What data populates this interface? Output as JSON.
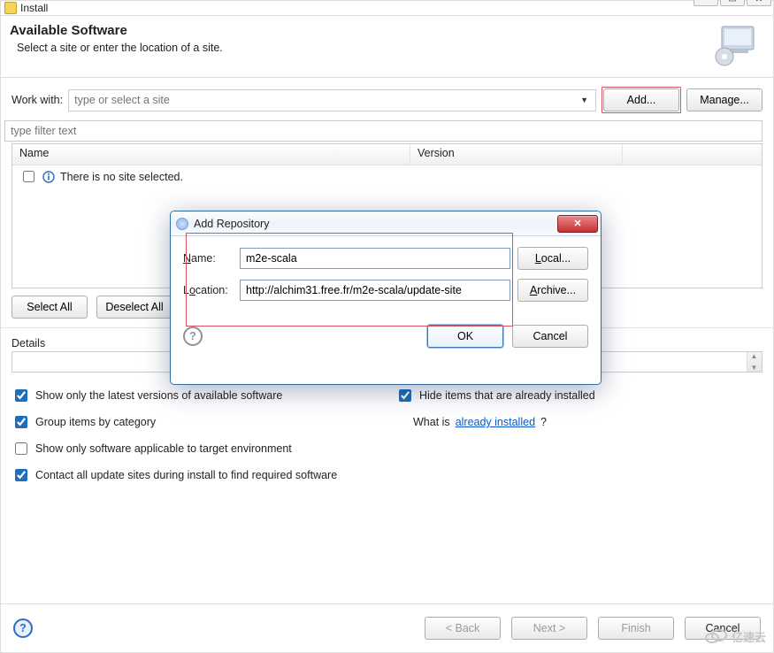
{
  "window": {
    "title": "Install"
  },
  "header": {
    "title": "Available Software",
    "subtitle": "Select a site or enter the location of a site."
  },
  "work_with": {
    "label": "Work with:",
    "placeholder": "type or select a site",
    "add": "Add...",
    "manage": "Manage..."
  },
  "filter": {
    "placeholder": "type filter text"
  },
  "table": {
    "col_name": "Name",
    "col_version": "Version",
    "empty_msg": "There is no site selected."
  },
  "buttons": {
    "select_all": "Select All",
    "deselect_all": "Deselect All"
  },
  "details": {
    "label": "Details"
  },
  "options": {
    "latest": "Show only the latest versions of available software",
    "hide_installed": "Hide items that are already installed",
    "group": "Group items by category",
    "whatis_pre": "What is ",
    "whatis_link": "already installed",
    "whatis_post": "?",
    "applicable": "Show only software applicable to target environment",
    "contact": "Contact all update sites during install to find required software"
  },
  "nav": {
    "back": "< Back",
    "next": "Next >",
    "finish": "Finish",
    "cancel": "Cancel"
  },
  "modal": {
    "title": "Add Repository",
    "name_label": "Name:",
    "name_value": "m2e-scala",
    "loc_label": "Location:",
    "loc_value": "http://alchim31.free.fr/m2e-scala/update-site",
    "local": "Local...",
    "archive": "Archive...",
    "ok": "OK",
    "cancel": "Cancel"
  },
  "watermark": "亿速云"
}
